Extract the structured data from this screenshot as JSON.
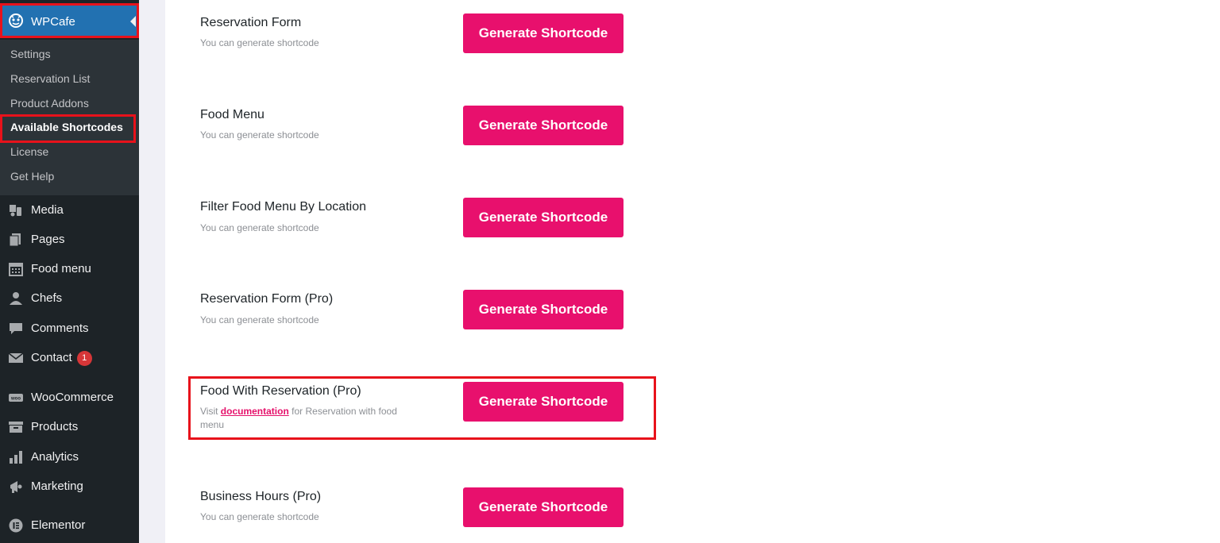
{
  "sidebar": {
    "brand": {
      "label": "WPCafe",
      "icon": "wpcafe-logo-icon"
    },
    "submenu": [
      {
        "label": "Settings"
      },
      {
        "label": "Reservation List"
      },
      {
        "label": "Product Addons"
      },
      {
        "label": "Available Shortcodes",
        "active": true
      },
      {
        "label": "License"
      },
      {
        "label": "Get Help"
      }
    ],
    "menu": [
      {
        "label": "Media",
        "icon": "media-icon"
      },
      {
        "label": "Pages",
        "icon": "pages-icon"
      },
      {
        "label": "Food menu",
        "icon": "calendar-icon"
      },
      {
        "label": "Chefs",
        "icon": "user-icon"
      },
      {
        "label": "Comments",
        "icon": "comment-icon"
      },
      {
        "label": "Contact",
        "icon": "mail-icon",
        "badge": "1"
      },
      {
        "label": "WooCommerce",
        "icon": "woocommerce-icon"
      },
      {
        "label": "Products",
        "icon": "archive-icon"
      },
      {
        "label": "Analytics",
        "icon": "bar-chart-icon"
      },
      {
        "label": "Marketing",
        "icon": "megaphone-icon"
      },
      {
        "label": "Elementor",
        "icon": "elementor-icon"
      }
    ]
  },
  "shortcodes": [
    {
      "title": "Reservation Form",
      "desc": "You can generate shortcode",
      "button": "Generate Shortcode"
    },
    {
      "title": "Food Menu",
      "desc": "You can generate shortcode",
      "button": "Generate Shortcode"
    },
    {
      "title": "Filter Food Menu By Location",
      "desc": "You can generate shortcode",
      "button": "Generate Shortcode"
    },
    {
      "title": "Reservation Form (Pro)",
      "desc": "You can generate shortcode",
      "button": "Generate Shortcode"
    },
    {
      "title": "Food With Reservation (Pro)",
      "desc_prefix": "Visit",
      "desc_link": "documentation",
      "desc_suffix": "for Reservation with food",
      "desc_line2": "menu",
      "button": "Generate Shortcode"
    },
    {
      "title": "Business Hours (Pro)",
      "desc": "You can generate shortcode",
      "button": "Generate Shortcode"
    }
  ],
  "colors": {
    "accent": "#e8106d",
    "sidebar_bg": "#1d2327",
    "highlight": "#e8121b",
    "wp_blue": "#2271b1"
  }
}
